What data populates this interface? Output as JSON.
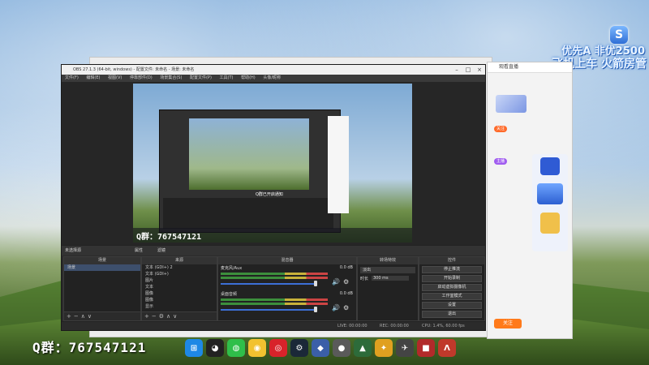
{
  "overlay": {
    "promo_line1": "优先A 非优2500",
    "promo_line2": "飞机上车 火箭房管",
    "badge_letter": "S",
    "qq_group": "Q群：767547121",
    "inner_qq_group": "Q群：767547121"
  },
  "obs": {
    "title": "OBS 27.1.3 (64-bit, windows) - 配置文件: 未命名 - 场景: 未命名",
    "menu": [
      "文件(F)",
      "编辑(E)",
      "视图(V)",
      "停靠部件(D)",
      "场景集合(S)",
      "配置文件(P)",
      "工具(T)",
      "帮助(H)",
      "头像/昵称"
    ],
    "preview_overlay_text": "Q群：767547121",
    "inner_status": "Q群已开启通知",
    "scene_strip": {
      "label": "未选择源",
      "props": "属性",
      "filters": "滤镜"
    },
    "docks": {
      "scenes": {
        "title": "场景",
        "items": [
          "场景"
        ]
      },
      "sources": {
        "title": "来源",
        "items": [
          "文本 (GDI+) 2",
          "文本 (GDI+)",
          "图片",
          "文本",
          "图像",
          "图像",
          "显示"
        ]
      },
      "mixer": {
        "title": "混音器",
        "channels": [
          {
            "name": "麦克风/Aux",
            "level": "0.0 dB"
          },
          {
            "name": "桌面音频",
            "level": "0.0 dB"
          }
        ]
      },
      "transitions": {
        "title": "转场特效",
        "type": "淡出",
        "duration_label": "时长",
        "duration_value": "300 ms"
      },
      "controls": {
        "title": "控件",
        "buttons": [
          "停止推流",
          "开始录制",
          "启动虚拟摄像机",
          "工作室模式",
          "设置",
          "退出"
        ]
      }
    },
    "status": {
      "live": "LIVE: 00:00:00",
      "rec": "REC: 00:00:00",
      "cpu": "CPU: 1.4%, 60.00 fps"
    }
  },
  "browser": {
    "tab_label": "观看直播",
    "buttons": [
      "关注",
      "主播"
    ],
    "orange_btn": "关注"
  },
  "taskbar": [
    "windows-icon",
    "qq-icon",
    "wechat-icon",
    "browser-icon",
    "netease-icon",
    "steam-icon",
    "game-icon",
    "game2-icon",
    "game3-icon",
    "game4-icon",
    "game5-icon",
    "game6-icon",
    "apex-icon"
  ],
  "colors": {
    "obs_bg": "#2b2b2b",
    "accent": "#3c6fd6",
    "orange": "#ff7a1a"
  }
}
